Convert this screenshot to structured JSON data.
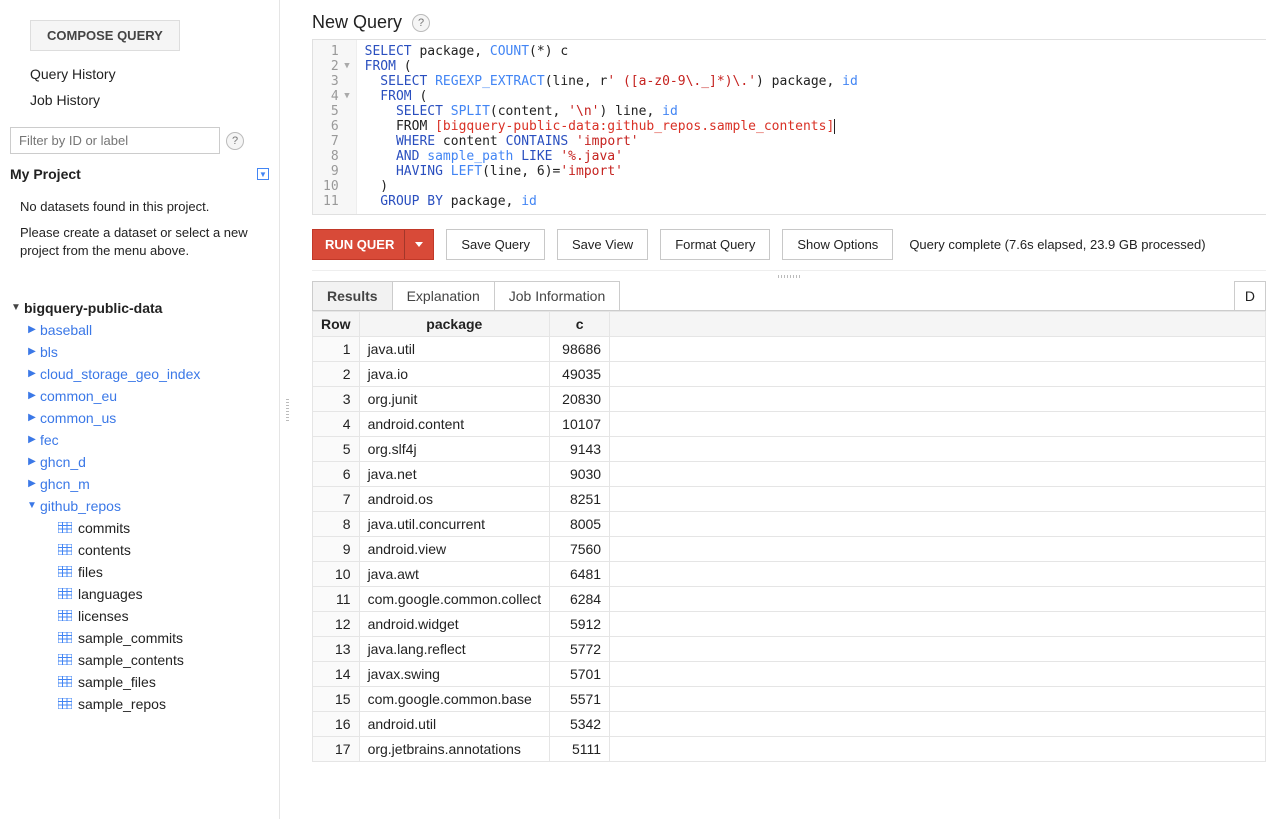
{
  "sidebar": {
    "compose_label": "COMPOSE QUERY",
    "query_history": "Query History",
    "job_history": "Job History",
    "filter_placeholder": "Filter by ID or label",
    "project_name": "My Project",
    "no_datasets_1": "No datasets found in this project.",
    "no_datasets_2": "Please create a dataset or select a new project from the menu above.",
    "public_root": "bigquery-public-data",
    "datasets": [
      {
        "name": "baseball",
        "expanded": false
      },
      {
        "name": "bls",
        "expanded": false
      },
      {
        "name": "cloud_storage_geo_index",
        "expanded": false
      },
      {
        "name": "common_eu",
        "expanded": false
      },
      {
        "name": "common_us",
        "expanded": false
      },
      {
        "name": "fec",
        "expanded": false
      },
      {
        "name": "ghcn_d",
        "expanded": false
      },
      {
        "name": "ghcn_m",
        "expanded": false
      },
      {
        "name": "github_repos",
        "expanded": true
      }
    ],
    "github_tables": [
      "commits",
      "contents",
      "files",
      "languages",
      "licenses",
      "sample_commits",
      "sample_contents",
      "sample_files",
      "sample_repos"
    ]
  },
  "main": {
    "title": "New Query",
    "editor_gutter": [
      "1",
      "2",
      "3",
      "4",
      "5",
      "6",
      "7",
      "8",
      "9",
      "10",
      "11"
    ],
    "fold_rows": [
      2,
      4
    ],
    "sql": {
      "l1": {
        "a": "SELECT",
        "b": " package, ",
        "c": "COUNT",
        "d": "(*) c"
      },
      "l2": {
        "a": "FROM",
        "b": " ("
      },
      "l3": {
        "a": "  SELECT",
        "b": " REGEXP_EXTRACT",
        "c": "(line, r",
        "d": "' ([a-z0-9\\._]*)\\.'",
        "e": ") package, ",
        "f": "id"
      },
      "l4": {
        "a": "  FROM",
        "b": " ("
      },
      "l5": {
        "a": "    SELECT",
        "b": " SPLIT",
        "c": "(content, ",
        "d": "'\\n'",
        "e": ") line, ",
        "f": "id"
      },
      "l6": {
        "a": "    FROM ",
        "b": "[bigquery-public-data:github_repos.sample_contents]"
      },
      "l7": {
        "a": "    WHERE",
        "b": " content ",
        "c": "CONTAINS ",
        "d": "'import'"
      },
      "l8": {
        "a": "    AND ",
        "b": "sample_path ",
        "c": "LIKE ",
        "d": "'%.java'"
      },
      "l9": {
        "a": "    HAVING",
        "b": " LEFT",
        "c": "(line, 6)=",
        "d": "'import'"
      },
      "l10": {
        "a": "  )"
      },
      "l11": {
        "a": "  GROUP BY",
        "b": " package, ",
        "c": "id"
      }
    },
    "buttons": {
      "run": "RUN QUER",
      "save_query": "Save Query",
      "save_view": "Save View",
      "format": "Format Query",
      "options": "Show Options"
    },
    "status": "Query complete (7.6s elapsed, 23.9 GB processed)",
    "tabs": {
      "results": "Results",
      "explanation": "Explanation",
      "jobinfo": "Job Information",
      "download": "D"
    },
    "headers": {
      "row": "Row",
      "package": "package",
      "c": "c"
    },
    "rows": [
      {
        "n": 1,
        "package": "java.util",
        "c": 98686
      },
      {
        "n": 2,
        "package": "java.io",
        "c": 49035
      },
      {
        "n": 3,
        "package": "org.junit",
        "c": 20830
      },
      {
        "n": 4,
        "package": "android.content",
        "c": 10107
      },
      {
        "n": 5,
        "package": "org.slf4j",
        "c": 9143
      },
      {
        "n": 6,
        "package": "java.net",
        "c": 9030
      },
      {
        "n": 7,
        "package": "android.os",
        "c": 8251
      },
      {
        "n": 8,
        "package": "java.util.concurrent",
        "c": 8005
      },
      {
        "n": 9,
        "package": "android.view",
        "c": 7560
      },
      {
        "n": 10,
        "package": "java.awt",
        "c": 6481
      },
      {
        "n": 11,
        "package": "com.google.common.collect",
        "c": 6284
      },
      {
        "n": 12,
        "package": "android.widget",
        "c": 5912
      },
      {
        "n": 13,
        "package": "java.lang.reflect",
        "c": 5772
      },
      {
        "n": 14,
        "package": "javax.swing",
        "c": 5701
      },
      {
        "n": 15,
        "package": "com.google.common.base",
        "c": 5571
      },
      {
        "n": 16,
        "package": "android.util",
        "c": 5342
      },
      {
        "n": 17,
        "package": "org.jetbrains.annotations",
        "c": 5111
      }
    ]
  }
}
